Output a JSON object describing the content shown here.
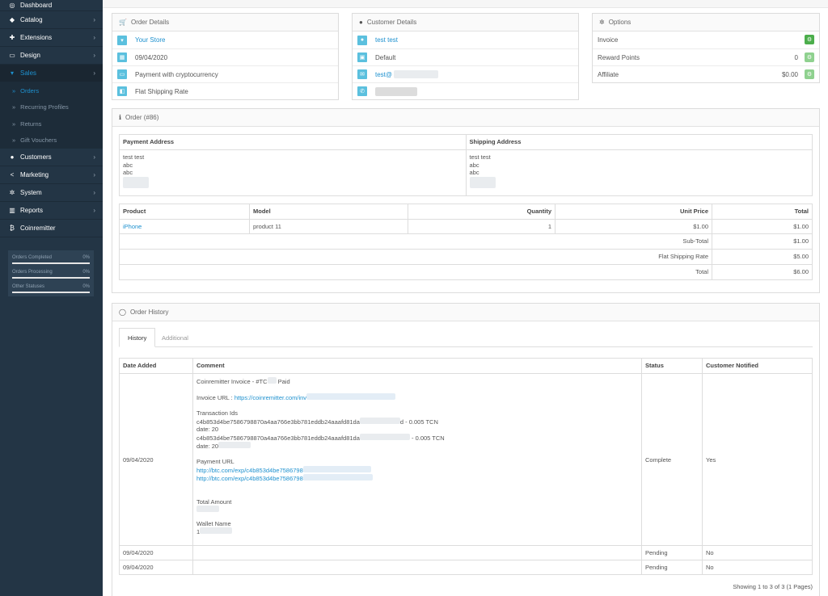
{
  "sidebar": {
    "items": [
      {
        "label": "Dashboard",
        "icon": "dashboard-icon"
      },
      {
        "label": "Catalog",
        "icon": "tag-icon"
      },
      {
        "label": "Extensions",
        "icon": "puzzle-icon"
      },
      {
        "label": "Design",
        "icon": "monitor-icon"
      },
      {
        "label": "Sales",
        "icon": "cart-icon"
      },
      {
        "label": "Customers",
        "icon": "user-icon"
      },
      {
        "label": "Marketing",
        "icon": "share-icon"
      },
      {
        "label": "System",
        "icon": "gear-icon"
      },
      {
        "label": "Reports",
        "icon": "bar-chart-icon"
      },
      {
        "label": "Coinremitter",
        "icon": "bitcoin-icon"
      }
    ],
    "sales_sub": [
      "Orders",
      "Recurring Profiles",
      "Returns",
      "Gift Vouchers"
    ],
    "stats": [
      {
        "label": "Orders Completed",
        "pct": "0%",
        "fill": 0
      },
      {
        "label": "Orders Processing",
        "pct": "0%",
        "fill": 0
      },
      {
        "label": "Other Statuses",
        "pct": "0%",
        "fill": 0
      }
    ]
  },
  "order_details": {
    "title": "Order Details",
    "store": "Your Store",
    "date": "09/04/2020",
    "payment": "Payment with cryptocurrency",
    "shipping": "Flat Shipping Rate"
  },
  "customer_details": {
    "title": "Customer Details",
    "name": "test test",
    "group": "Default",
    "email": "test@"
  },
  "options": {
    "title": "Options",
    "invoice": "Invoice",
    "reward_points": "Reward Points",
    "reward_value": "0",
    "affiliate": "Affiliate",
    "affiliate_value": "$0.00"
  },
  "order": {
    "title": "Order (#86)",
    "payment_address_head": "Payment Address",
    "shipping_address_head": "Shipping Address",
    "payment_address": [
      "test test",
      "abc",
      "abc"
    ],
    "shipping_address": [
      "test test",
      "abc",
      "abc"
    ],
    "columns": [
      "Product",
      "Model",
      "Quantity",
      "Unit Price",
      "Total"
    ],
    "product": {
      "name": "iPhone",
      "model": "product 11",
      "quantity": "1",
      "unit_price": "$1.00",
      "total": "$1.00"
    },
    "totals": [
      {
        "label": "Sub-Total",
        "value": "$1.00"
      },
      {
        "label": "Flat Shipping Rate",
        "value": "$5.00"
      },
      {
        "label": "Total",
        "value": "$6.00"
      }
    ]
  },
  "history": {
    "title": "Order History",
    "tabs": [
      "History",
      "Additional"
    ],
    "columns": [
      "Date Added",
      "Comment",
      "Status",
      "Customer Notified"
    ],
    "rows": [
      {
        "date": "09/04/2020",
        "status": "Complete",
        "notified": "Yes"
      },
      {
        "date": "09/04/2020",
        "status": "Pending",
        "notified": "No"
      },
      {
        "date": "09/04/2020",
        "status": "Pending",
        "notified": "No"
      }
    ],
    "comment": {
      "invoice_prefix": "Coinremitter Invoice - #TC",
      "invoice_suffix": "Paid",
      "invoice_url_label": "Invoice URL :",
      "invoice_url": "https://coinremitter.com/inv",
      "tx_label": "Transaction Ids",
      "tx1": "c4b853d4be7586798870a4aa766e3bb781eddb24aaafd81da",
      "tx1_suffix": "d - 0.005 TCN",
      "tx1_date": "date: 20",
      "tx2": "c4b853d4be7586798870a4aa766e3bb781eddb24aaafd81da",
      "tx2_suffix": "- 0.005 TCN",
      "tx2_date": "date: 20",
      "payment_url_label": "Payment URL",
      "payment_url1": "http://btc.com/exp/c4b853d4be7586798",
      "payment_url2": "http://btc.com/exp/c4b853d4be7586798",
      "total_amount_label": "Total Amount",
      "wallet_label": "Wallet Name",
      "wallet_value": "1"
    },
    "pagination": "Showing 1 to 3 of 3 (1 Pages)"
  },
  "colors": {
    "sidebar": "#233545",
    "accent": "#1e91cf",
    "info": "#5bc0de",
    "success": "#4cae4c"
  }
}
